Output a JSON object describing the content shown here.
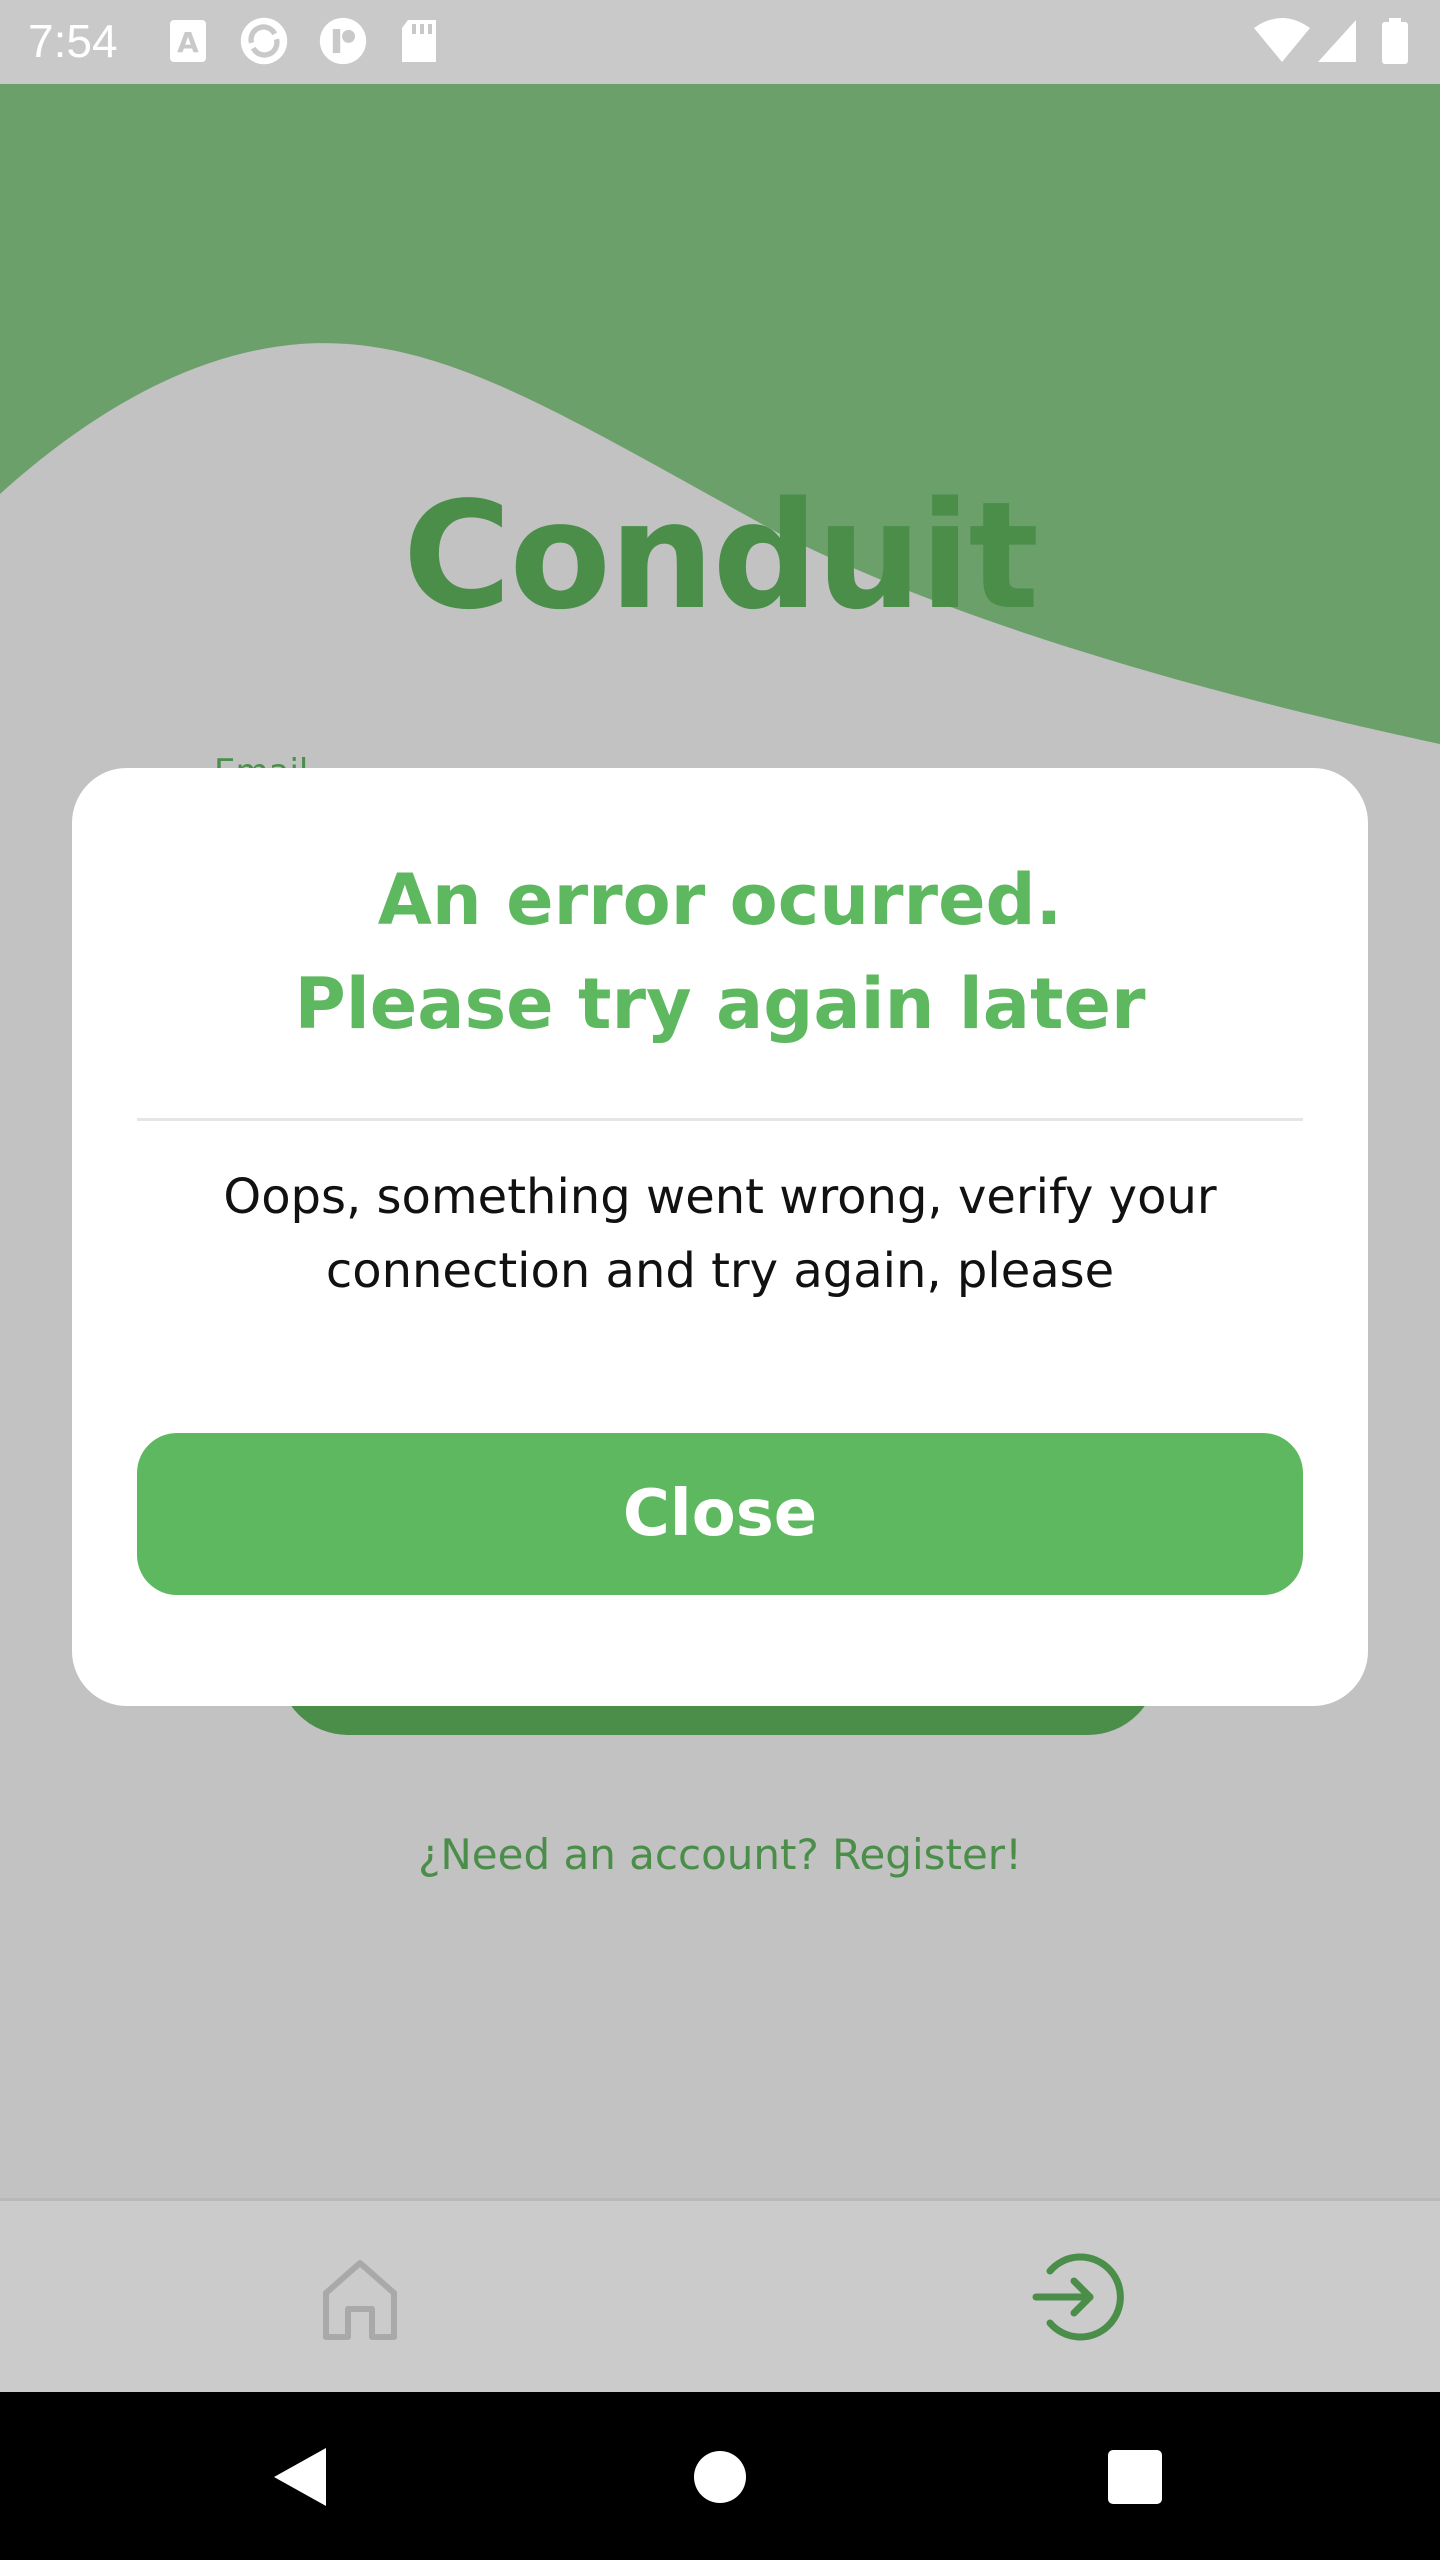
{
  "status_bar": {
    "time": "7:54",
    "left_icons": [
      "font-a-icon",
      "sync-app-icon",
      "app-logo-icon",
      "sd-card-icon"
    ],
    "right_icons": [
      "wifi-icon",
      "signal-icon",
      "battery-icon"
    ]
  },
  "header": {
    "app_title": "Conduit",
    "brand_color": "#6ba06b"
  },
  "login_form": {
    "email_label": "Email",
    "register_link": "¿Need an account? Register!"
  },
  "dialog": {
    "title_line1": "An error ocurred.",
    "title_line2": "Please try again later",
    "message": "Oops, something went wrong, verify your connection and try again, please",
    "close_label": "Close",
    "accent_color": "#5db85f"
  },
  "tab_bar": {
    "items": [
      {
        "icon": "home-icon",
        "active": false
      },
      {
        "icon": "login-icon",
        "active": true
      }
    ]
  },
  "nav_bar": {
    "buttons": [
      "back-icon",
      "home-circle-icon",
      "recents-icon"
    ]
  }
}
